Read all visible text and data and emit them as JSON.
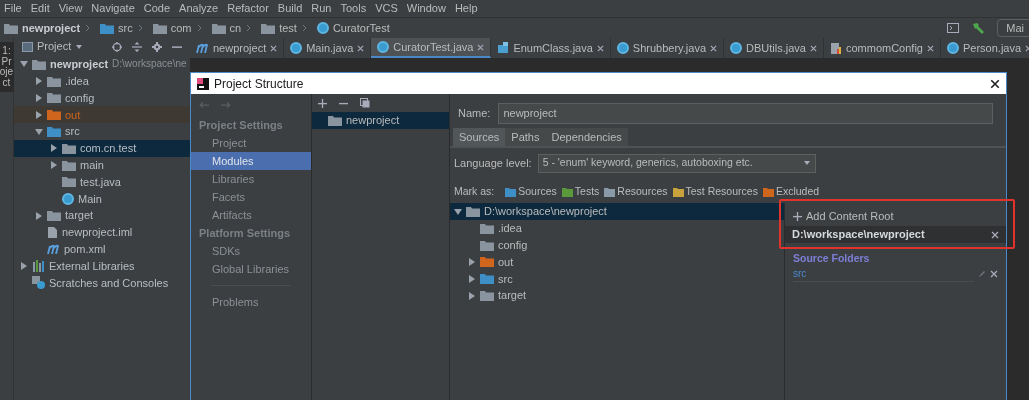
{
  "menu_bar": [
    "File",
    "Edit",
    "View",
    "Navigate",
    "Code",
    "Analyze",
    "Refactor",
    "Build",
    "Run",
    "Tools",
    "VCS",
    "Window",
    "Help"
  ],
  "breadcrumb": [
    {
      "label": "newproject",
      "kind": "module"
    },
    {
      "label": "src",
      "kind": "source"
    },
    {
      "label": "com",
      "kind": "package"
    },
    {
      "label": "cn",
      "kind": "package"
    },
    {
      "label": "test",
      "kind": "package"
    },
    {
      "label": "CuratorTest",
      "kind": "class"
    }
  ],
  "run_config": "Mai",
  "side_stripe": {
    "label": "1: Project"
  },
  "project_panel": {
    "title": "Project",
    "tree": [
      {
        "label": "newproject",
        "path": "D:\\workspace\\ne",
        "kind": "module",
        "expanded": true,
        "selected": false,
        "children": [
          {
            "label": ".idea",
            "kind": "folder",
            "expanded": false,
            "selected": false
          },
          {
            "label": "config",
            "kind": "folder",
            "expanded": false,
            "selected": false
          },
          {
            "label": "out",
            "kind": "excluded",
            "expanded": false,
            "selected": false
          },
          {
            "label": "src",
            "kind": "source",
            "expanded": true,
            "selected": false,
            "children": [
              {
                "label": "com.cn.test",
                "kind": "package",
                "expanded": false,
                "selected": true
              },
              {
                "label": "main",
                "kind": "package",
                "expanded": false,
                "selected": false
              },
              {
                "label": "test.java",
                "kind": "package",
                "selected": false
              },
              {
                "label": "Main",
                "kind": "class",
                "selected": false
              }
            ]
          },
          {
            "label": "target",
            "kind": "folder",
            "expanded": false,
            "selected": false
          },
          {
            "label": "newproject.iml",
            "kind": "file",
            "selected": false
          },
          {
            "label": "pom.xml",
            "kind": "maven",
            "selected": false
          }
        ]
      },
      {
        "label": "External Libraries",
        "kind": "libraries",
        "expanded": false,
        "selected": false
      },
      {
        "label": "Scratches and Consoles",
        "kind": "scratches",
        "selected": false
      }
    ]
  },
  "editor_tabs": [
    {
      "label": "newproject",
      "kind": "maven",
      "selected": false
    },
    {
      "label": "Main.java",
      "kind": "class",
      "selected": false
    },
    {
      "label": "CuratorTest.java",
      "kind": "class",
      "selected": true
    },
    {
      "label": "EnumClass.java",
      "kind": "enum",
      "selected": false
    },
    {
      "label": "Shrubbery.java",
      "kind": "class",
      "selected": false
    },
    {
      "label": "DBUtils.java",
      "kind": "class",
      "selected": false
    },
    {
      "label": "commomConfig",
      "kind": "config",
      "selected": false
    },
    {
      "label": "Person.java",
      "kind": "class",
      "selected": false
    }
  ],
  "dialog": {
    "title": "Project Structure",
    "sidebar": [
      {
        "kind": "header",
        "label": "Project Settings"
      },
      {
        "kind": "item",
        "label": "Project",
        "selected": false
      },
      {
        "kind": "item",
        "label": "Modules",
        "selected": true
      },
      {
        "kind": "item",
        "label": "Libraries",
        "selected": false
      },
      {
        "kind": "item",
        "label": "Facets",
        "selected": false
      },
      {
        "kind": "item",
        "label": "Artifacts",
        "selected": false
      },
      {
        "kind": "header",
        "label": "Platform Settings"
      },
      {
        "kind": "item",
        "label": "SDKs",
        "selected": false
      },
      {
        "kind": "item",
        "label": "Global Libraries",
        "selected": false
      },
      {
        "kind": "separator"
      },
      {
        "kind": "item",
        "label": "Problems",
        "selected": false
      }
    ],
    "modules": [
      {
        "label": "newproject",
        "selected": true
      }
    ],
    "name_label": "Name:",
    "name_value": "newproject",
    "tabs": [
      {
        "label": "Sources",
        "selected": true
      },
      {
        "label": "Paths",
        "selected": false
      },
      {
        "label": "Dependencies",
        "selected": false
      }
    ],
    "language_level_label": "Language level:",
    "language_level": "5 - 'enum' keyword, generics, autoboxing etc.",
    "mark_as_label": "Mark as:",
    "mark_as": [
      {
        "label": "Sources",
        "color": "#3d8fc6"
      },
      {
        "label": "Tests",
        "color": "#5b9a3c"
      },
      {
        "label": "Resources",
        "color": "#8a9aa8"
      },
      {
        "label": "Test Resources",
        "color": "#c8a23c"
      },
      {
        "label": "Excluded",
        "color": "#d0661e"
      }
    ],
    "content_tree": {
      "label": "D:\\workspace\\newproject",
      "expanded": true,
      "selected": true,
      "children": [
        {
          "label": ".idea",
          "kind": "folder"
        },
        {
          "label": "config",
          "kind": "folder"
        },
        {
          "label": "out",
          "kind": "excluded",
          "expanded": false
        },
        {
          "label": "src",
          "kind": "source",
          "expanded": false
        },
        {
          "label": "target",
          "kind": "folder",
          "expanded": false
        }
      ]
    },
    "add_content_root": "Add Content Root",
    "content_root": "D:\\workspace\\newproject",
    "source_folders_title": "Source Folders",
    "source_folders": [
      "src"
    ]
  }
}
